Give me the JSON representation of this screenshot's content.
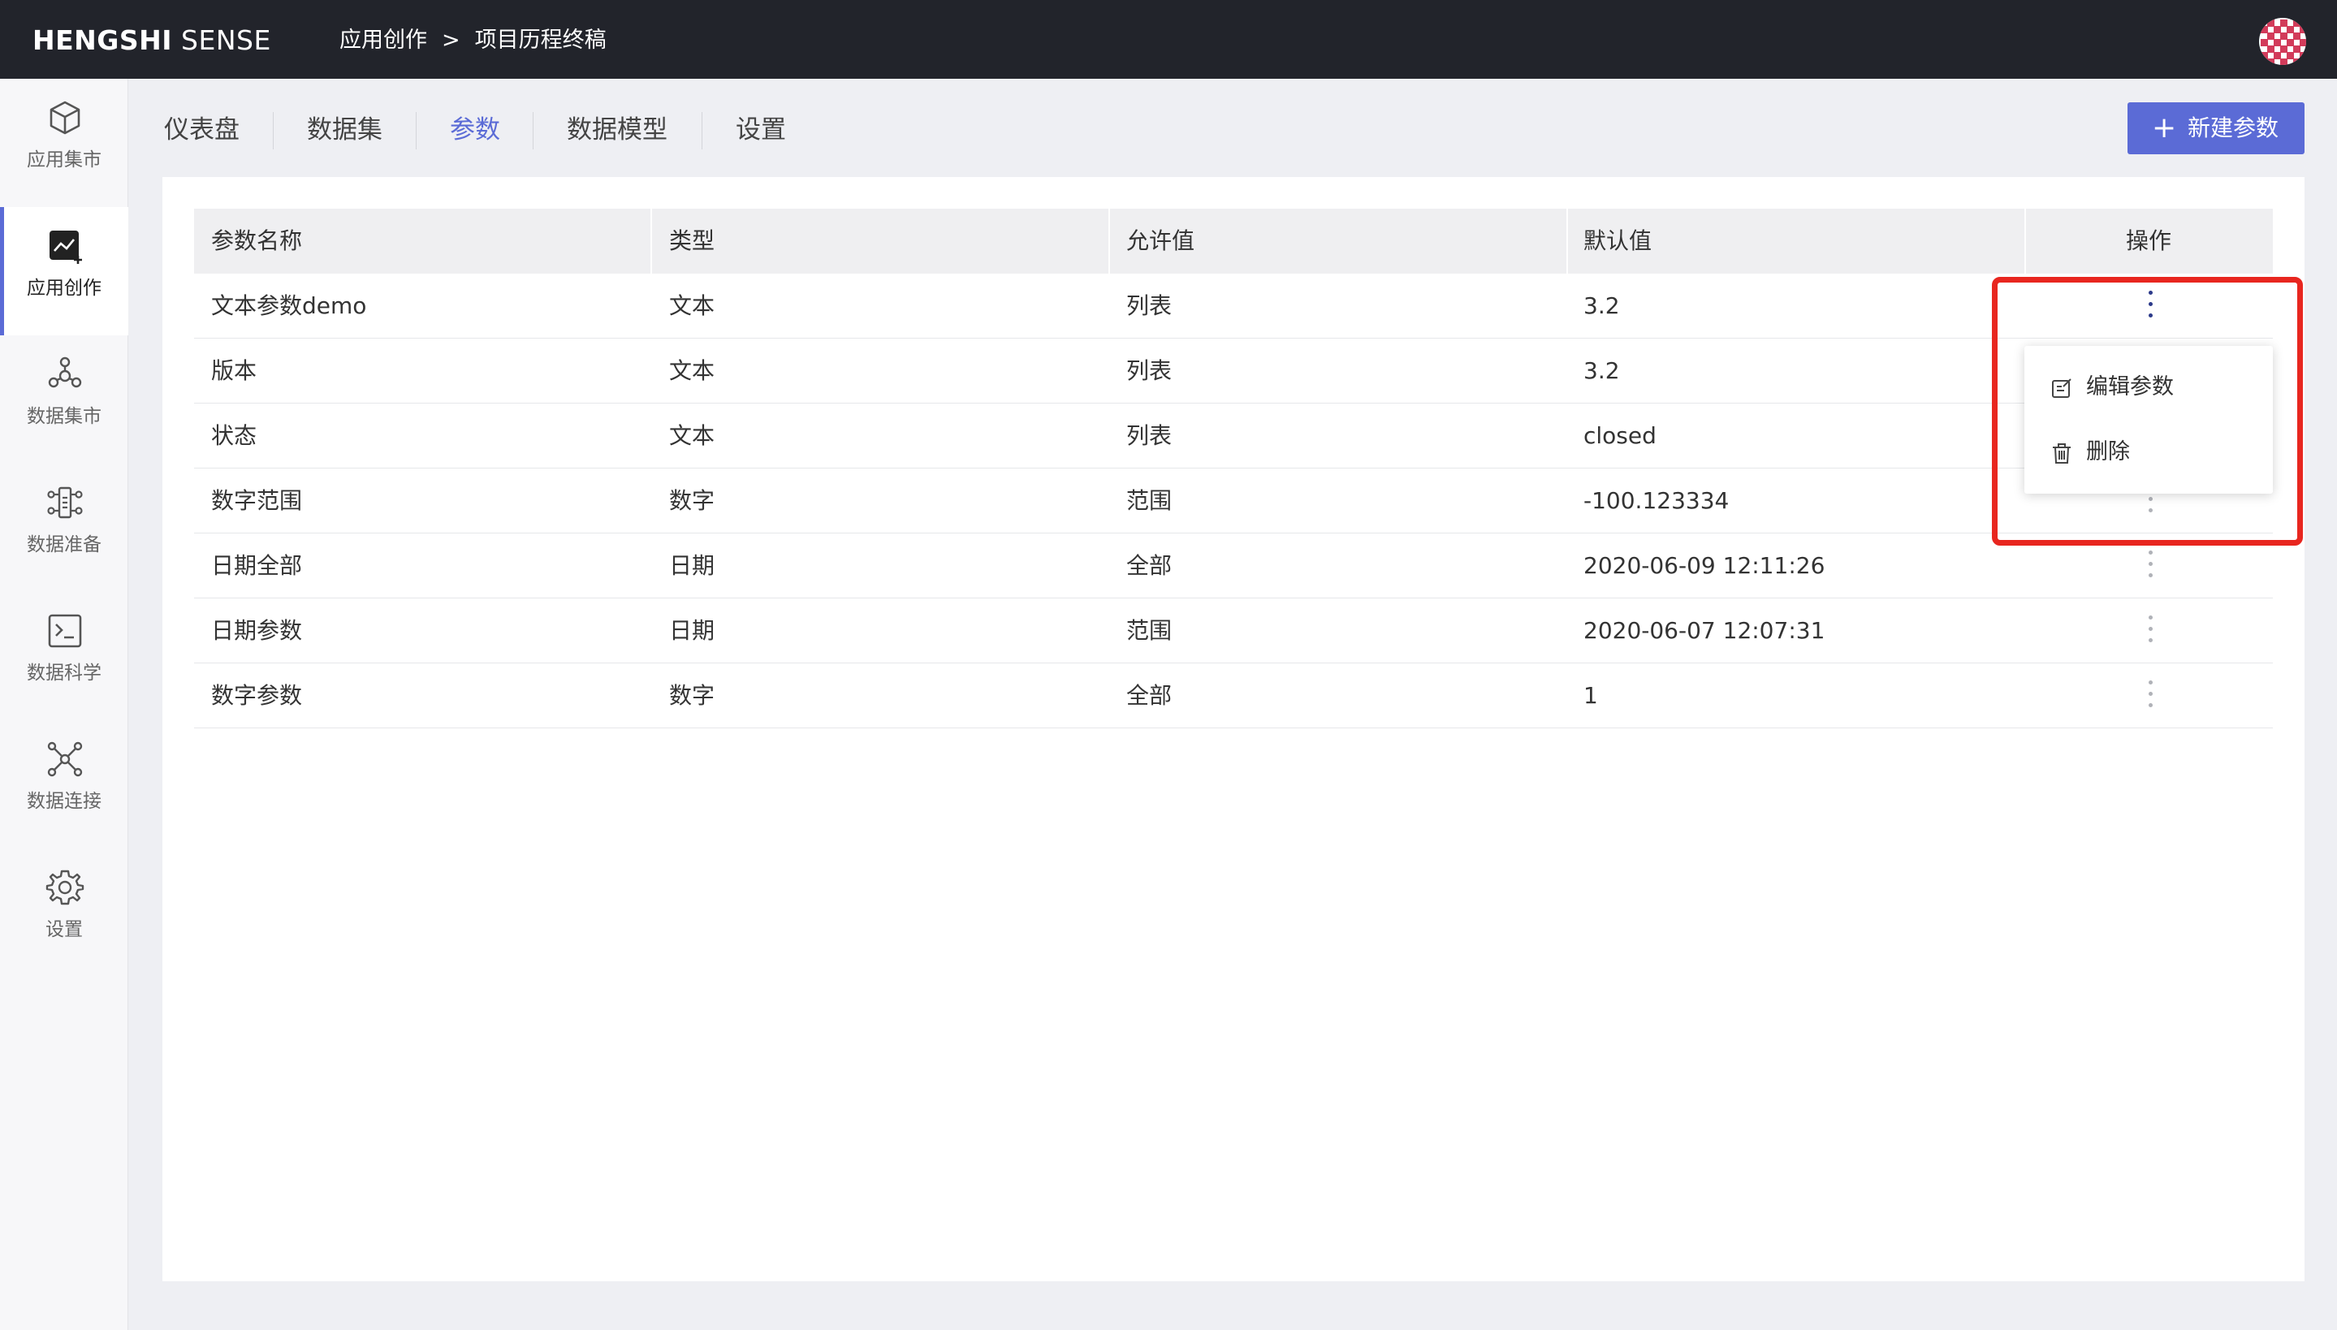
{
  "app": {
    "brand_bold": "HENGSHI",
    "brand_light": "SENSE"
  },
  "breadcrumb": {
    "items": [
      "应用创作",
      "项目历程终稿"
    ],
    "separator": ">"
  },
  "sidebar": {
    "items": [
      {
        "label": "应用集市",
        "icon": "cube-icon"
      },
      {
        "label": "应用创作",
        "icon": "chart-create-icon",
        "active": true
      },
      {
        "label": "数据集市",
        "icon": "data-mart-icon"
      },
      {
        "label": "数据准备",
        "icon": "data-prep-icon"
      },
      {
        "label": "数据科学",
        "icon": "terminal-icon"
      },
      {
        "label": "数据连接",
        "icon": "network-icon"
      },
      {
        "label": "设置",
        "icon": "gear-icon"
      }
    ]
  },
  "tabs": [
    {
      "label": "仪表盘"
    },
    {
      "label": "数据集"
    },
    {
      "label": "参数",
      "active": true
    },
    {
      "label": "数据模型"
    },
    {
      "label": "设置"
    }
  ],
  "new_button": {
    "label": "新建参数"
  },
  "table": {
    "columns": [
      "参数名称",
      "类型",
      "允许值",
      "默认值",
      "操作"
    ],
    "rows": [
      [
        "文本参数demo",
        "文本",
        "列表",
        "3.2"
      ],
      [
        "版本",
        "文本",
        "列表",
        "3.2"
      ],
      [
        "状态",
        "文本",
        "列表",
        "closed"
      ],
      [
        "数字范围",
        "数字",
        "范围",
        "-100.123334"
      ],
      [
        "日期全部",
        "日期",
        "全部",
        "2020-06-09 12:11:26"
      ],
      [
        "日期参数",
        "日期",
        "范围",
        "2020-06-07 12:07:31"
      ],
      [
        "数字参数",
        "数字",
        "全部",
        "1"
      ]
    ]
  },
  "menu": {
    "items": [
      {
        "label": "编辑参数",
        "icon": "edit-icon"
      },
      {
        "label": "删除",
        "icon": "trash-icon"
      }
    ]
  },
  "colors": {
    "accent": "#5b6bd6",
    "topbar": "#22242b",
    "highlight": "#e8261f"
  }
}
